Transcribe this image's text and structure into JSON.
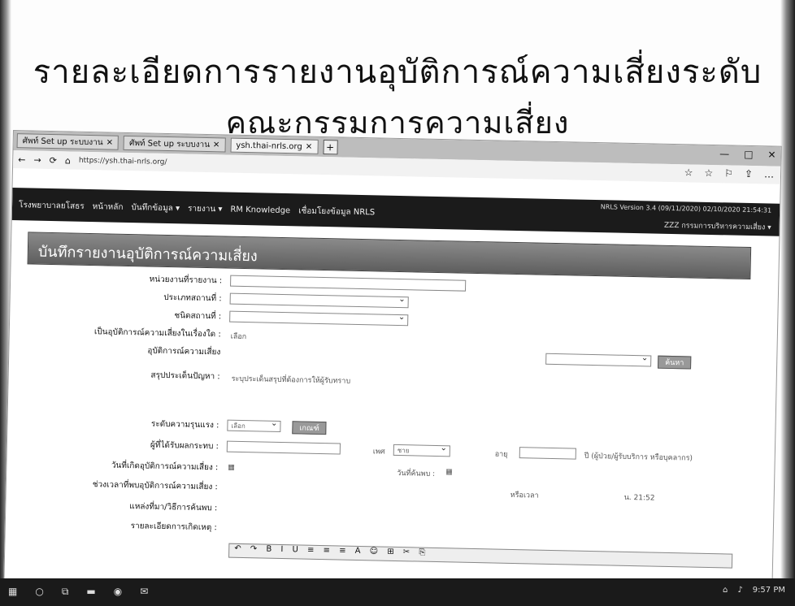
{
  "slide": {
    "title_line1": "รายละเอียดการรายงานอุบัติการณ์ความเสี่ยงระดับ",
    "title_line2": "คณะกรรมการความเสี่ยง"
  },
  "browser": {
    "tabs": [
      {
        "label": "ศัพท์ Set up ระบบงาน",
        "active": false
      },
      {
        "label": "ศัพท์ Set up ระบบงาน",
        "active": false
      },
      {
        "label": "ysh.thai-nrls.org",
        "active": true
      }
    ],
    "new_tab_icon": "+",
    "url": "https://ysh.thai-nrls.org/",
    "window_controls": [
      "—",
      "□",
      "✕"
    ],
    "nav_icons": [
      "←",
      "→",
      "⟳",
      "⌂"
    ],
    "right_icons": [
      "☆",
      "☆",
      "⚐",
      "⇪",
      "…"
    ]
  },
  "app": {
    "org_name": "โรงพยาบาลยโสธร",
    "nav": [
      "หน้าหลัก",
      "บันทึกข้อมูล ▾",
      "รายงาน ▾",
      "RM Knowledge",
      "เชื่อมโยงข้อมูล NRLS"
    ],
    "version": "NRLS Version 3.4 (09/11/2020) 02/10/2020 21:54:31",
    "user": "ZZZ กรรมการบริหารความเสี่ยง ▾"
  },
  "panel": {
    "title": "บันทึกรายงานอุบัติการณ์ความเสี่ยง"
  },
  "form": {
    "fields": [
      {
        "label": "หน่วยงานที่รายงาน :"
      },
      {
        "label": "ประเภทสถานที่ :"
      },
      {
        "label": "ชนิดสถานที่ :"
      },
      {
        "label": "เป็นอุบัติการณ์ความเสี่ยงในเรื่องใด :",
        "value": "เลือก"
      },
      {
        "label": "อุบัติการณ์ความเสี่ยง",
        "button": "ค้นหา"
      },
      {
        "label": "สรุปประเด็นปัญหา :",
        "hint": "ระบุประเด็นสรุปที่ต้องการให้ผู้รับทราบ"
      },
      {
        "label": "ระดับความรุนแรง :",
        "value": "เลือก",
        "button": "เกณฑ์"
      },
      {
        "label": "ผู้ที่ได้รับผลกระทบ :",
        "extra1": "เพศ",
        "extra2": "ชาย",
        "extra3": "อายุ",
        "note": "ปี (ผู้ป่วย/ผู้รับบริการ หรือบุคลากร)"
      },
      {
        "label": "วันที่เกิดอุบัติการณ์ความเสี่ยง :",
        "extra1": "วันที่ค้นพบ :"
      },
      {
        "label": "ช่วงเวลาที่พบอุบัติการณ์ความเสี่ยง :",
        "extra1": "หรือเวลา",
        "extra2": "น. 21:52"
      },
      {
        "label": "แหล่งที่มา/วิธีการค้นพบ :"
      },
      {
        "label": "รายละเอียดการเกิดเหตุ :"
      }
    ],
    "editor_toolbar": "↶ ↷ B I U ≡ ≡ ≡ A ☺ ⊞ ✂ ⎘"
  },
  "taskbar": {
    "start_icon": "▦",
    "time": "9:57 PM"
  }
}
